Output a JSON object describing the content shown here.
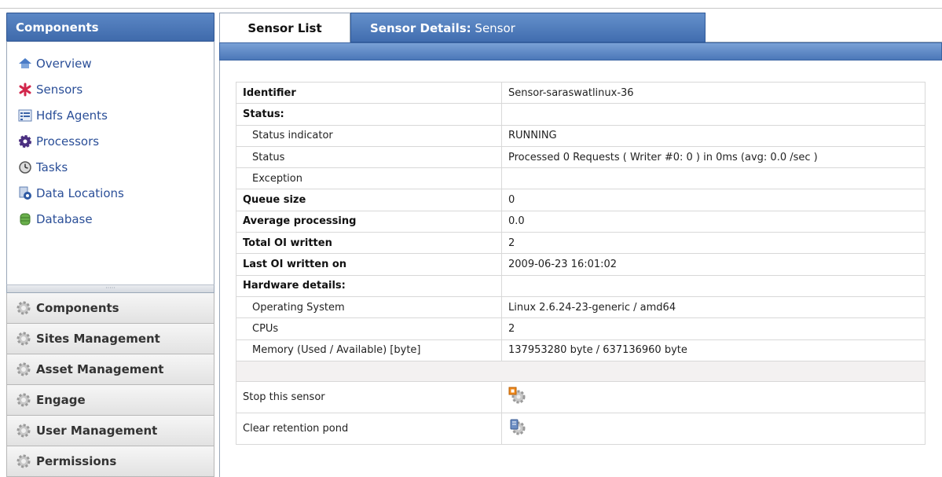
{
  "sidebar": {
    "header": "Components",
    "nav_items": [
      {
        "label": "Overview",
        "icon": "house-icon"
      },
      {
        "label": "Sensors",
        "icon": "asterisk-icon"
      },
      {
        "label": "Hdfs Agents",
        "icon": "list-icon"
      },
      {
        "label": "Processors",
        "icon": "gear-icon"
      },
      {
        "label": "Tasks",
        "icon": "clock-icon"
      },
      {
        "label": "Data Locations",
        "icon": "location-doc-icon"
      },
      {
        "label": "Database",
        "icon": "database-icon"
      }
    ],
    "splitter_glyph": "·····",
    "accordion": [
      "Components",
      "Sites Management",
      "Asset Management",
      "Engage",
      "User Management",
      "Permissions"
    ]
  },
  "tabs": {
    "list_label": "Sensor List",
    "details_prefix": "Sensor Details:",
    "details_name": "Sensor"
  },
  "details": {
    "identifier": {
      "label": "Identifier",
      "value": "Sensor-saraswatlinux-36"
    },
    "status_header": "Status:",
    "status_indicator": {
      "label": "Status indicator",
      "value": "RUNNING"
    },
    "status": {
      "label": "Status",
      "value": "Processed 0 Requests ( Writer #0: 0 ) in 0ms (avg: 0.0 /sec )"
    },
    "exception": {
      "label": "Exception",
      "value": ""
    },
    "queue_size": {
      "label": "Queue size",
      "value": "0"
    },
    "average_processing": {
      "label": "Average processing",
      "value": "0.0"
    },
    "total_oi_written": {
      "label": "Total OI written",
      "value": "2"
    },
    "last_oi_written_on": {
      "label": "Last OI written on",
      "value": "2009-06-23 16:01:02"
    },
    "hardware_header": "Hardware details:",
    "operating_system": {
      "label": "Operating System",
      "value": "Linux 2.6.24-23-generic / amd64"
    },
    "cpus": {
      "label": "CPUs",
      "value": "2"
    },
    "memory": {
      "label": "Memory (Used / Available) [byte]",
      "value": "137953280 byte / 637136960 byte"
    }
  },
  "actions": {
    "stop_label": "Stop this sensor",
    "clear_label": "Clear retention pond"
  },
  "colors": {
    "accent_blue": "#4b77b8",
    "link_blue": "#2b4f98",
    "stop_orange": "#f08a1c"
  }
}
